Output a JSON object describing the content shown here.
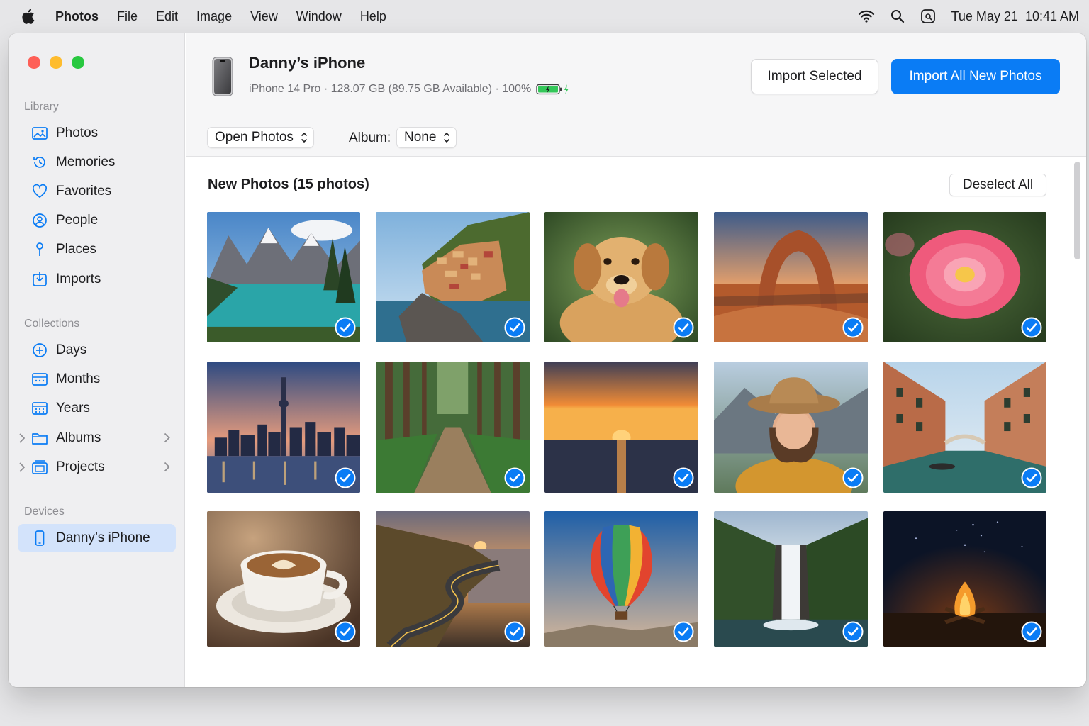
{
  "menubar": {
    "app": "Photos",
    "items": [
      "File",
      "Edit",
      "Image",
      "View",
      "Window",
      "Help"
    ],
    "clock": "Tue May 21  10:41 AM"
  },
  "sidebar": {
    "library_title": "Library",
    "library": [
      {
        "label": "Photos",
        "icon": "photos-icon"
      },
      {
        "label": "Memories",
        "icon": "memories-icon"
      },
      {
        "label": "Favorites",
        "icon": "heart-icon"
      },
      {
        "label": "People",
        "icon": "person-icon"
      },
      {
        "label": "Places",
        "icon": "pin-icon"
      },
      {
        "label": "Imports",
        "icon": "import-icon"
      }
    ],
    "collections_title": "Collections",
    "collections": [
      {
        "label": "Days",
        "icon": "days-icon"
      },
      {
        "label": "Months",
        "icon": "calendar-icon"
      },
      {
        "label": "Years",
        "icon": "calendar-icon"
      },
      {
        "label": "Albums",
        "icon": "folder-icon"
      },
      {
        "label": "Projects",
        "icon": "projects-icon"
      }
    ],
    "devices_title": "Devices",
    "device": {
      "label": "Danny’s iPhone",
      "icon": "iphone-icon"
    }
  },
  "device": {
    "name": "Danny’s iPhone",
    "info": "iPhone 14 Pro · 128.07 GB (89.75 GB Available) · 100%",
    "battery_level": 1.0
  },
  "buttons": {
    "import_selected": "Import Selected",
    "import_all": "Import All New Photos",
    "deselect_all": "Deselect All"
  },
  "toolbar": {
    "open_in": "Open Photos",
    "album_label": "Album:",
    "album_value": "None"
  },
  "gallery": {
    "title": "New Photos (15 photos)",
    "photos": [
      {
        "subject": "mountain lake",
        "selected": true
      },
      {
        "subject": "cliffside village",
        "selected": true
      },
      {
        "subject": "golden retriever",
        "selected": true
      },
      {
        "subject": "desert arch",
        "selected": true
      },
      {
        "subject": "pink dahlia",
        "selected": true
      },
      {
        "subject": "city skyline",
        "selected": true
      },
      {
        "subject": "forest path",
        "selected": true
      },
      {
        "subject": "ocean sunset",
        "selected": true
      },
      {
        "subject": "woman in hat",
        "selected": true
      },
      {
        "subject": "canal",
        "selected": true
      },
      {
        "subject": "latte",
        "selected": false
      },
      {
        "subject": "coastal road",
        "selected": true
      },
      {
        "subject": "hot air balloon",
        "selected": true
      },
      {
        "subject": "waterfall",
        "selected": true
      },
      {
        "subject": "campfire",
        "selected": true
      }
    ]
  },
  "colors": {
    "accent": "#0a7cf5",
    "close": "#fe5f57",
    "minimize": "#febc2e",
    "zoom": "#28c840",
    "sidebar_active": "#d3e3fb"
  }
}
